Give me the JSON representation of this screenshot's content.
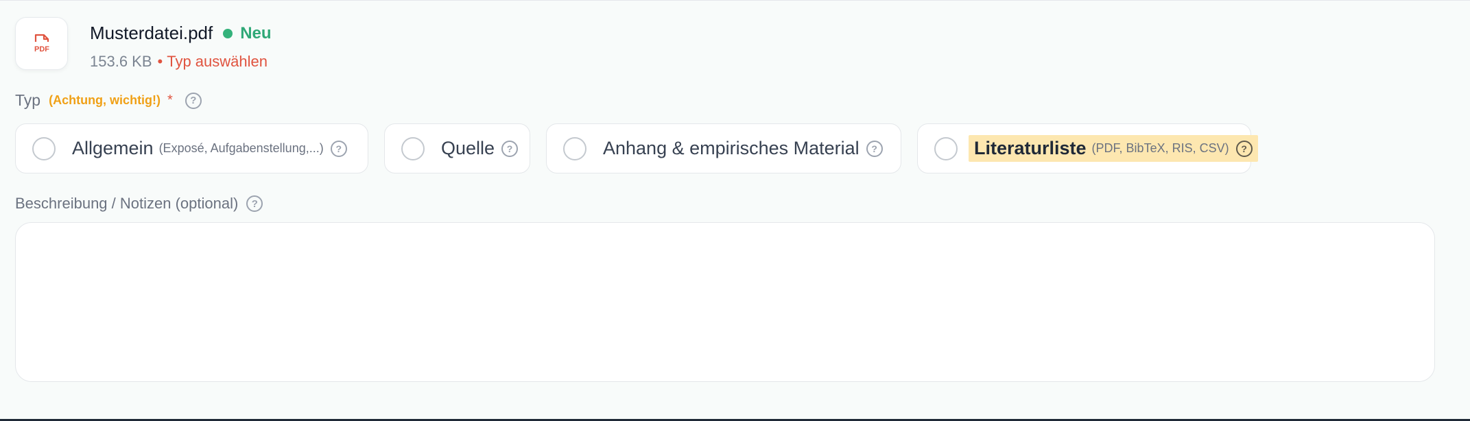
{
  "file": {
    "name": "Musterdatei.pdf",
    "status": "Neu",
    "size": "153.6 KB",
    "separator": "•",
    "type_hint": "Typ auswählen",
    "icon_label": "PDF"
  },
  "type_field": {
    "label": "Typ",
    "note": "(Achtung, wichtig!)",
    "required_mark": "*",
    "help": "?",
    "options": [
      {
        "label": "Allgemein",
        "hint": "(Exposé, Aufgabenstellung,...)",
        "help": "?"
      },
      {
        "label": "Quelle",
        "hint": "",
        "help": "?"
      },
      {
        "label": "Anhang & empirisches Material",
        "hint": "",
        "help": "?"
      },
      {
        "label": "Literaturliste",
        "hint": "(PDF, BibTeX, RIS, CSV)",
        "help": "?"
      }
    ]
  },
  "description": {
    "label": "Beschreibung / Notizen (optional)",
    "help": "?",
    "value": "",
    "placeholder": ""
  },
  "colors": {
    "status_green": "#34b27b",
    "error_red": "#e0533f",
    "warning_orange": "#f0a016",
    "highlight": "#fde7b0"
  },
  "icons": [
    "pdf-file-icon",
    "status-dot-icon",
    "help-icon",
    "radio-icon"
  ]
}
